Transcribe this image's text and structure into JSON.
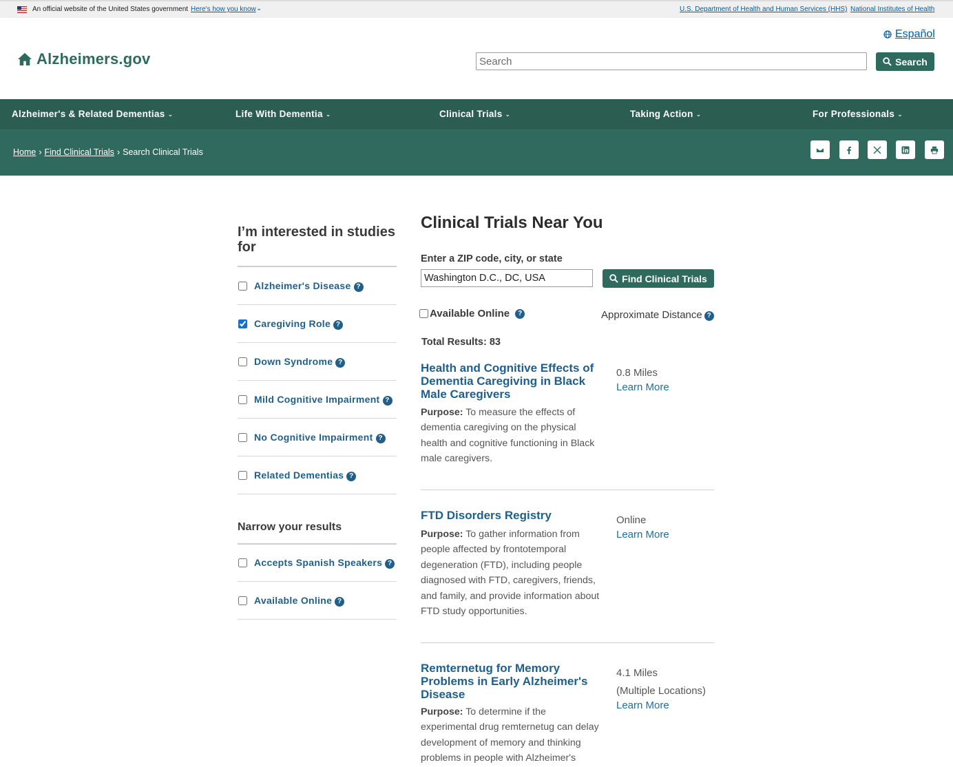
{
  "gov_banner": {
    "official_text": "An official website of the United States government",
    "how_you_know": "Here's how you know",
    "hhs_link": "U.S. Department of Health and Human Services (HHS)",
    "nih_link": "National Institutes of Health"
  },
  "header": {
    "logo_text": "Alzheimers.gov",
    "language_link": "Español",
    "search_placeholder": "Search",
    "search_button": "Search"
  },
  "nav": {
    "items": [
      {
        "label": "Alzheimer's & Related Dementias"
      },
      {
        "label": "Life With Dementia"
      },
      {
        "label": "Clinical Trials"
      },
      {
        "label": "Taking Action"
      },
      {
        "label": "For Professionals"
      }
    ]
  },
  "breadcrumb": {
    "home": "Home",
    "find": "Find Clinical Trials",
    "current": "Search Clinical Trials",
    "separator": "›"
  },
  "filters": {
    "title": "I’m interested in studies for",
    "items": [
      {
        "label": "Alzheimer's Disease",
        "checked": false
      },
      {
        "label": "Caregiving Role",
        "checked": true
      },
      {
        "label": "Down Syndrome",
        "checked": false
      },
      {
        "label": "Mild Cognitive Impairment",
        "checked": false
      },
      {
        "label": "No Cognitive Impairment",
        "checked": false
      },
      {
        "label": "Related Dementias",
        "checked": false
      }
    ],
    "narrow_title": "Narrow your results",
    "narrow_items": [
      {
        "label": "Accepts Spanish Speakers",
        "checked": false
      },
      {
        "label": "Available Online",
        "checked": false
      }
    ]
  },
  "main": {
    "title": "Clinical Trials Near You",
    "zip_label": "Enter a ZIP code, city, or state",
    "zip_value": "Washington D.C., DC, USA",
    "find_button": "Find Clinical Trials",
    "available_online": "Available Online",
    "approx_distance": "Approximate Distance",
    "total_results": "Total Results: 83",
    "help_glyph": "?",
    "purpose_label": "Purpose:",
    "results": [
      {
        "title": "Health and Cognitive Effects of Dementia Caregiving in Black Male Caregivers",
        "purpose": "To measure the effects of dementia caregiving on the physical health and cognitive functioning in Black male caregivers.",
        "distance": "0.8 Miles",
        "extra": "",
        "learn_more": "Learn More"
      },
      {
        "title": "FTD Disorders Registry",
        "purpose": "To gather information from people affected by frontotemporal degeneration (FTD), including people diagnosed with FTD, caregivers, friends, and family, and provide information about FTD study opportunities.",
        "distance": "Online",
        "extra": "",
        "learn_more": "Learn More"
      },
      {
        "title": "Remternetug for Memory Problems in Early Alzheimer's Disease",
        "purpose": "To determine if the experimental drug remternetug can delay development of memory and thinking problems in people with Alzheimer's",
        "distance": "4.1 Miles",
        "extra": "(Multiple Locations)",
        "learn_more": "Learn More"
      }
    ]
  },
  "colors": {
    "brand_green": "#2e6b5e",
    "nav_green": "#2c5d51",
    "band_green": "#30695d",
    "link_blue": "#1f5f8a"
  },
  "icons": {
    "flag": "us-flag-icon",
    "logo": "home-icon",
    "language": "globe-icon",
    "search": "magnifier-icon",
    "share": [
      "email-icon",
      "facebook-icon",
      "x-icon",
      "linkedin-icon",
      "print-icon"
    ]
  }
}
